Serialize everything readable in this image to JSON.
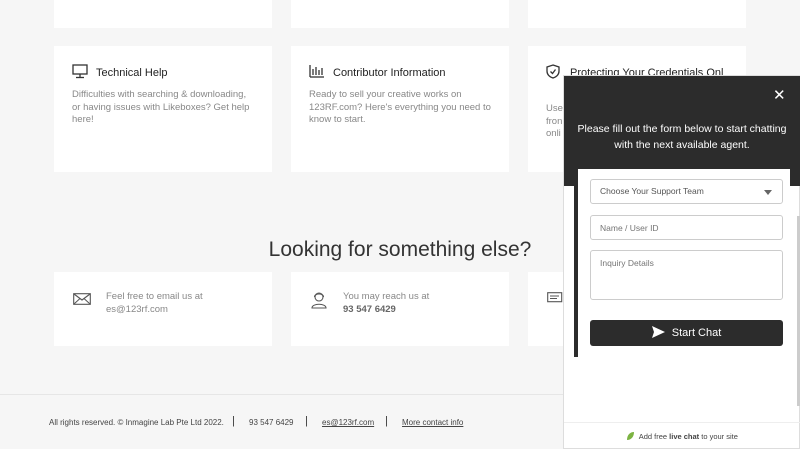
{
  "help_cards": [
    {
      "title": "Technical Help",
      "description": "Difficulties with searching & downloading, or having issues with Likeboxes? Get help here!",
      "icon": "monitor-icon"
    },
    {
      "title": "Contributor Information",
      "description": "Ready to sell your creative works on 123RF.com? Here's everything you need to know to start.",
      "icon": "bar-chart-icon"
    },
    {
      "title": "Protecting Your Credentials Onl",
      "description_lines": [
        "Use",
        "fron",
        "onli"
      ],
      "icon": "shield-icon"
    }
  ],
  "section_heading": "Looking for something else?",
  "contact": {
    "email_line1": "Feel free to email us at",
    "email_line2": "es@123rf.com",
    "phone_line1": "You may reach us at",
    "phone_line2": "93 547 6429"
  },
  "footer": {
    "copyright": "All rights reserved. © Inmagine Lab Pte Ltd 2022.",
    "phone": "93 547 6429",
    "email": "es@123rf.com",
    "more": "More contact info",
    "separator": "|"
  },
  "chat": {
    "close": "✕",
    "message": "Please fill out the form below to start chatting with the next available agent.",
    "team_select": "Choose Your Support Team",
    "name_placeholder": "Name / User ID",
    "details_placeholder": "Inquiry Details",
    "start_button": "Start Chat",
    "footer_pre": "Add free ",
    "footer_bold": "live chat",
    "footer_post": " to your site"
  },
  "colors": {
    "dark": "#2c2c2c",
    "bg": "#f6f6f6",
    "card": "#ffffff"
  }
}
